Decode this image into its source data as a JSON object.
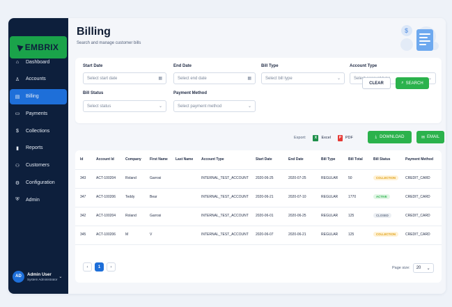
{
  "brand": {
    "name": "EMBRIX"
  },
  "sidebar": {
    "items": [
      {
        "label": "Dashboard",
        "icon": "home-icon"
      },
      {
        "label": "Accounts",
        "icon": "user-icon"
      },
      {
        "label": "Billing",
        "icon": "document-icon",
        "active": true
      },
      {
        "label": "Payments",
        "icon": "card-icon"
      },
      {
        "label": "Collections",
        "icon": "dollar-circle-icon"
      },
      {
        "label": "Reports",
        "icon": "bar-chart-icon"
      },
      {
        "label": "Customers",
        "icon": "users-icon"
      },
      {
        "label": "Configuration",
        "icon": "gear-icon"
      },
      {
        "label": "Admin",
        "icon": "shield-icon"
      }
    ],
    "user": {
      "initials": "AD",
      "name": "Admin User",
      "role": "System Administrator"
    }
  },
  "page": {
    "title": "Billing",
    "subtitle": "Search and manage customer bills"
  },
  "filters": {
    "start_date": {
      "label": "Start Date",
      "placeholder": "Select start date"
    },
    "end_date": {
      "label": "End Date",
      "placeholder": "Select end date"
    },
    "bill_type": {
      "label": "Bill Type",
      "placeholder": "Select bill type"
    },
    "account_type": {
      "label": "Account Type",
      "placeholder": "Select account type"
    },
    "bill_status": {
      "label": "Bill Status",
      "placeholder": "Select status"
    },
    "payment_method": {
      "label": "Payment Method",
      "placeholder": "Select payment method"
    },
    "clear_label": "CLEAR",
    "search_label": "SEARCH"
  },
  "export": {
    "label": "Export:",
    "excel_label": "Excel",
    "pdf_label": "PDF",
    "download_label": "DOWNLOAD",
    "email_label": "EMAIL"
  },
  "table": {
    "columns": [
      "Id",
      "Account Id",
      "Company",
      "First Name",
      "Last Name",
      "Account Type",
      "Start Date",
      "End Date",
      "Bill Type",
      "Bill Total",
      "Bill Status",
      "Payment Method"
    ],
    "rows": [
      [
        "343",
        "ACT-100204",
        "Roland",
        "Garrosi",
        "",
        "INTERNAL_TEST_ACCOUNT",
        "2020-06-25",
        "2020-07-25",
        "REGULAR",
        "50",
        "COLLECTION",
        "CREDIT_CARD"
      ],
      [
        "347",
        "ACT-100206",
        "Teddy",
        "Bear",
        "",
        "INTERNAL_TEST_ACCOUNT",
        "2020-06-21",
        "2020-07-10",
        "REGULAR",
        "1770",
        "ACTIVE",
        "CREDIT_CARD"
      ],
      [
        "342",
        "ACT-100204",
        "Roland",
        "Garrosi",
        "",
        "INTERNAL_TEST_ACCOUNT",
        "2020-06-01",
        "2020-06-25",
        "REGULAR",
        "125",
        "CLOSED",
        "CREDIT_CARD"
      ],
      [
        "345",
        "ACT-100206",
        "M",
        "V",
        "",
        "INTERNAL_TEST_ACCOUNT",
        "2020-06-07",
        "2020-06-21",
        "REGULAR",
        "125",
        "COLLECTION",
        "CREDIT_CARD"
      ]
    ],
    "status_colors": {
      "COLLECTION": {
        "bg": "#fff2d6",
        "fg": "#e0a21a"
      },
      "ACTIVE": {
        "bg": "#e2f6e6",
        "fg": "#2bb24c"
      },
      "CLOSED": {
        "bg": "#eceff3",
        "fg": "#6b778c"
      }
    }
  },
  "pagination": {
    "current_page": "1",
    "page_size_label": "Page size:",
    "page_size": "20"
  },
  "colors": {
    "sidebar": "#0d1f3c",
    "accent": "#1e6fd9",
    "brand_green": "#1aa34a",
    "button_green": "#2bb24c"
  }
}
